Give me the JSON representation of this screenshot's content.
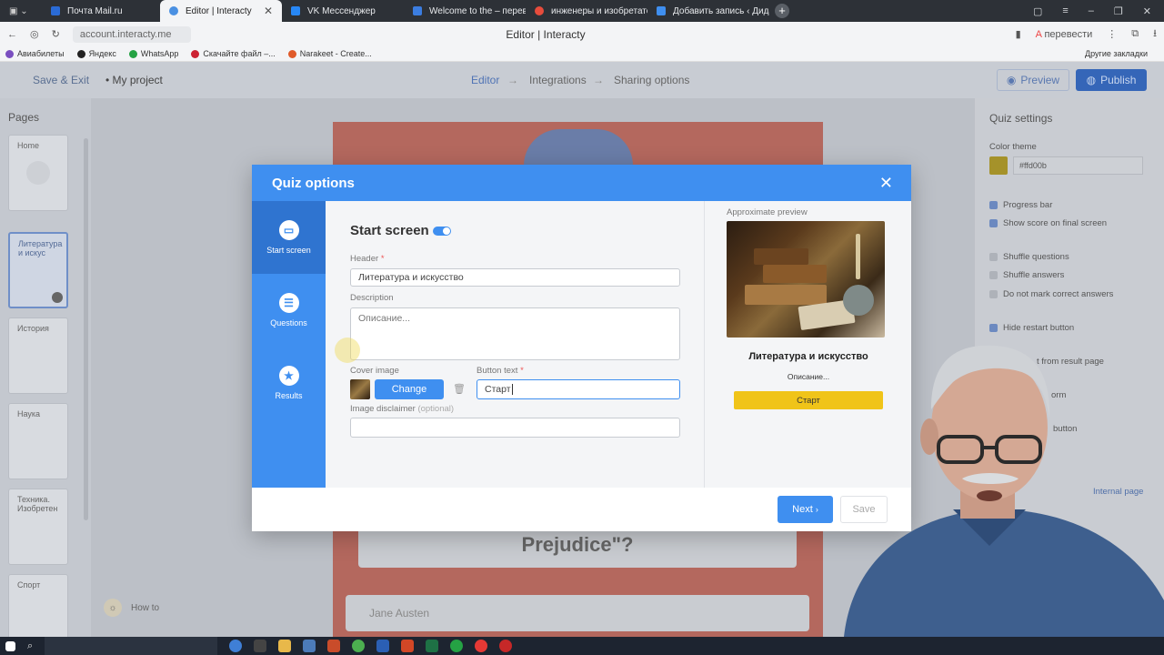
{
  "browser": {
    "tabs": [
      {
        "label": "Почта Mail.ru",
        "color": "#2a6bd6"
      },
      {
        "label": "Editor | Interacty",
        "color": "#4a90e2",
        "active": true
      },
      {
        "label": "VK Мессенджер",
        "color": "#2787f5"
      },
      {
        "label": "Welcome to the – перевод",
        "color": "#3b7de0"
      },
      {
        "label": "инженеры и изобретате...",
        "color": "#e74c3c"
      },
      {
        "label": "Добавить запись ‹ Дида...",
        "color": "#3f8ff0"
      }
    ],
    "url": "account.interacty.me",
    "page_title": "Editor | Interacty",
    "translate_label": "перевести",
    "bookmarks": [
      "Авиабилеты",
      "Яндекс",
      "WhatsApp",
      "Скачайте файл –...",
      "Narakeet - Create..."
    ],
    "other_bookmarks": "Другие закладки"
  },
  "app": {
    "save_exit": "Save & Exit",
    "project": "My project",
    "steps": [
      "Editor",
      "Integrations",
      "Sharing options"
    ],
    "preview": "Preview",
    "publish": "Publish"
  },
  "pages": {
    "title": "Pages",
    "items": [
      "Home",
      "Литература и искус",
      "История",
      "Наука",
      "Техника. Изобретен",
      "Спорт"
    ]
  },
  "canvas": {
    "question_fragment": "Prejudice\"?",
    "answer": "Jane Austen",
    "howto": "How to"
  },
  "settings": {
    "title": "Quiz settings",
    "color_theme_label": "Color theme",
    "color_value": "#ffd00b",
    "color": "#d9b21c",
    "options": [
      {
        "label": "Progress bar",
        "checked": true
      },
      {
        "label": "Show score on final screen",
        "checked": true
      },
      {
        "label": "Shuffle questions",
        "checked": false
      },
      {
        "label": "Shuffle answers",
        "checked": false
      },
      {
        "label": "Do not mark correct answers",
        "checked": false
      },
      {
        "label": "Hide restart button",
        "checked": true
      }
    ],
    "restart_fragment": "t from result page",
    "form_fragment": "orm",
    "button_fragment": "button",
    "internal_page": "Internal page"
  },
  "modal": {
    "title": "Quiz options",
    "nav": [
      {
        "label": "Start screen",
        "icon": "start-screen-icon"
      },
      {
        "label": "Questions",
        "icon": "questions-icon"
      },
      {
        "label": "Results",
        "icon": "results-star-icon"
      }
    ],
    "section_title": "Start screen",
    "header_label": "Header",
    "header_value": "Литература и искусство",
    "description_label": "Description",
    "description_placeholder": "Описание...",
    "cover_label": "Cover image",
    "change_button": "Change",
    "button_text_label": "Button text",
    "button_text_value": "Старт",
    "disclaimer_label": "Image disclaimer",
    "optional": "(optional)",
    "preview_label": "Approximate preview",
    "preview_title": "Литература и искусство",
    "preview_desc": "Описание...",
    "preview_button": "Старт",
    "next": "Next",
    "save": "Save"
  }
}
